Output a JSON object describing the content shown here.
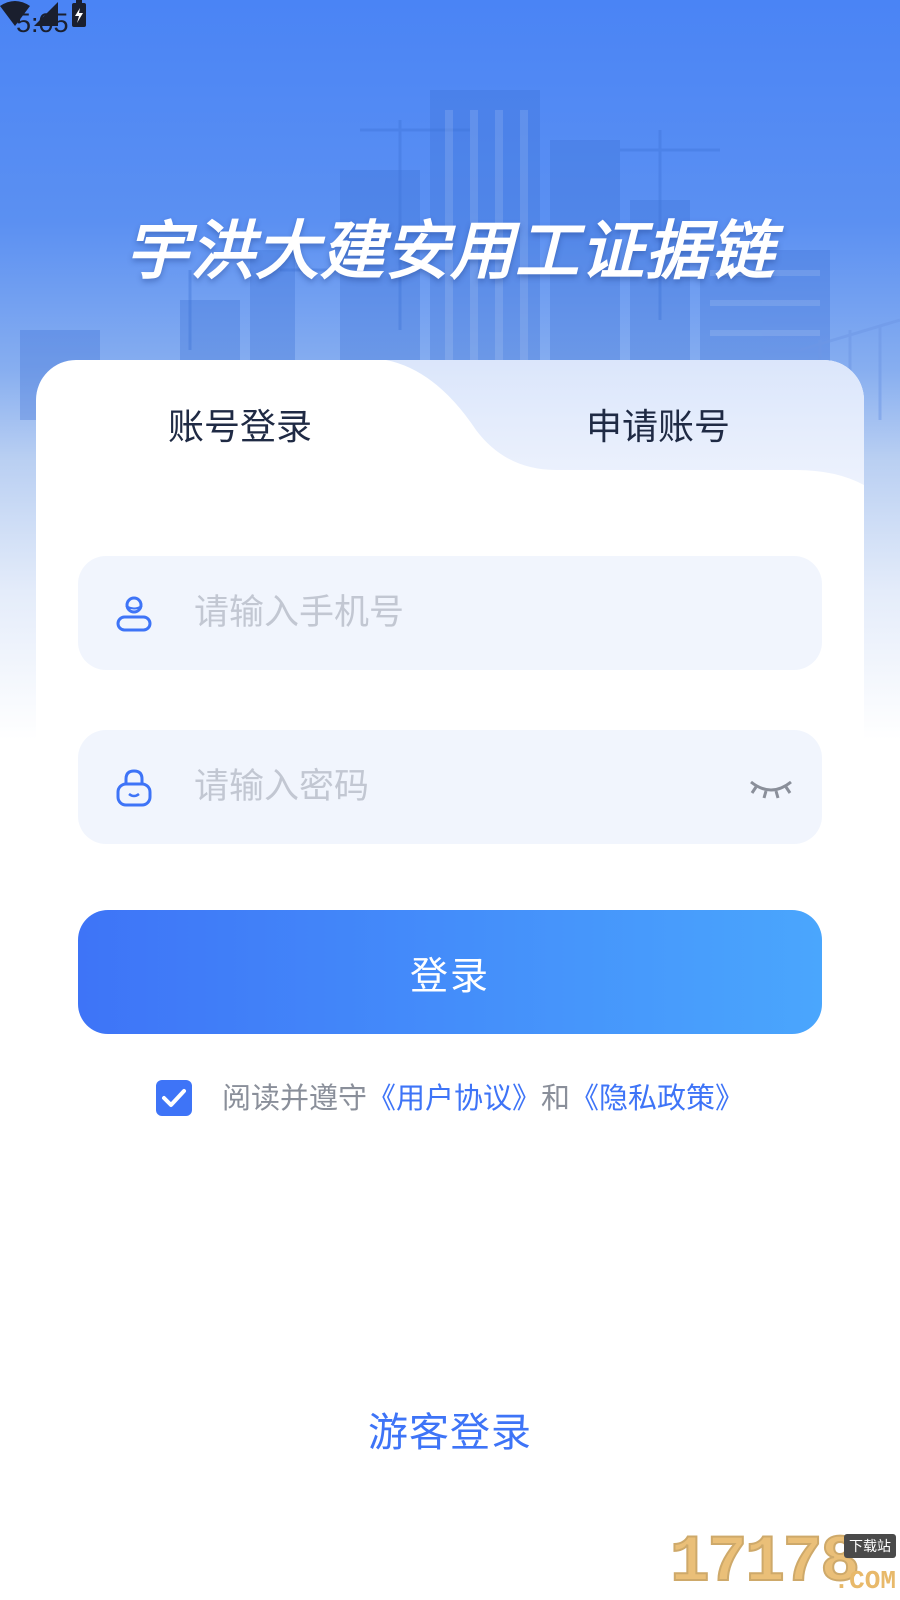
{
  "status_bar": {
    "time": "5:05"
  },
  "app": {
    "title": "宇洪大建安用工证据链"
  },
  "tabs": [
    {
      "label": "账号登录",
      "active": true
    },
    {
      "label": "申请账号",
      "active": false
    }
  ],
  "form": {
    "phone_placeholder": "请输入手机号",
    "password_placeholder": "请输入密码"
  },
  "login_button": "登录",
  "agreement": {
    "checked": true,
    "prefix": "阅读并遵守",
    "user_agreement": "《用户协议》",
    "and": "和",
    "privacy_policy": "《隐私政策》"
  },
  "guest_login": "游客登录",
  "watermark": {
    "number": "17178",
    "tag": "下载站",
    "suffix": ".COM"
  },
  "colors": {
    "accent": "#3e74f7",
    "gradient_end": "#4aa6fd",
    "header_blue": "#4a84f5"
  }
}
